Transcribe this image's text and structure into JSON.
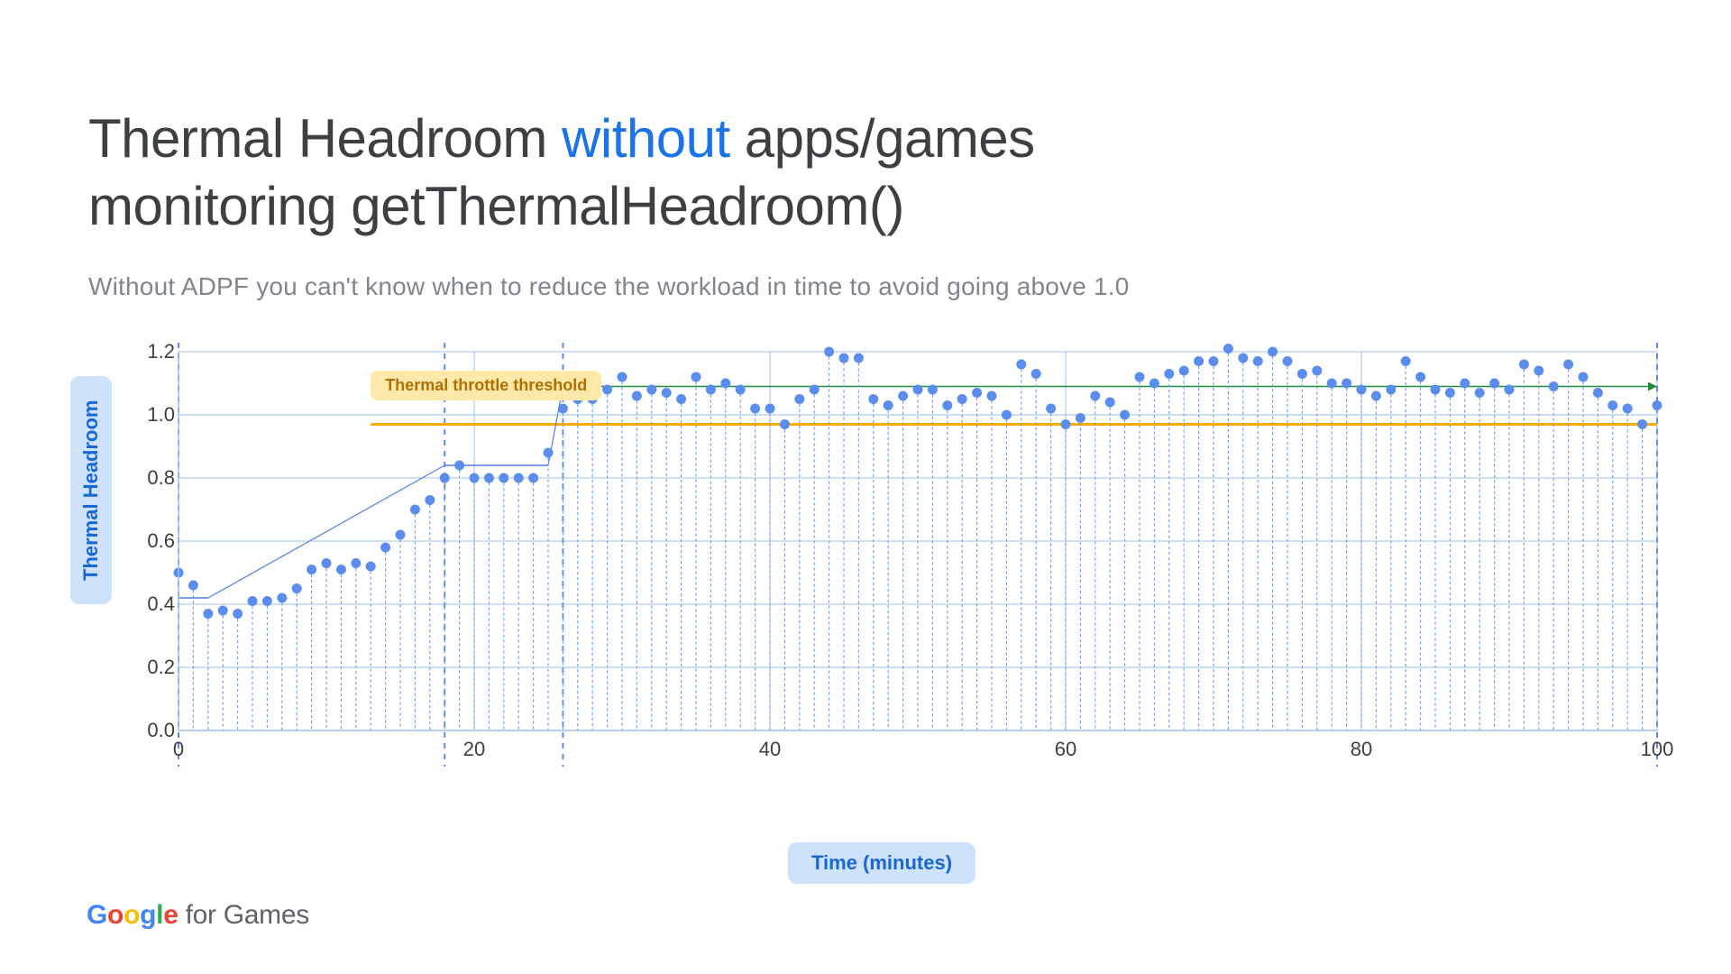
{
  "title_prefix": "Thermal Headroom ",
  "title_accent": "without",
  "title_suffix": " apps/games\nmonitoring getThermalHeadroom()",
  "subtitle": "Without ADPF you can't know when to reduce the workload in time to avoid going above 1.0",
  "ylabel": "Thermal Headroom",
  "xlabel": "Time (minutes)",
  "threshold_label": "Thermal throttle threshold",
  "footer_suffix": " for Games",
  "chart_data": {
    "type": "scatter",
    "title": "Thermal Headroom without apps/games monitoring getThermalHeadroom()",
    "xlabel": "Time (minutes)",
    "ylabel": "Thermal Headroom",
    "xlim": [
      0,
      100
    ],
    "ylim": [
      0.0,
      1.2
    ],
    "xticks": [
      0,
      20,
      40,
      60,
      80,
      100
    ],
    "yticks": [
      0.0,
      0.2,
      0.4,
      0.6,
      0.8,
      1.0,
      1.2
    ],
    "reference_lines": {
      "thermal_throttle_threshold_y": 0.97,
      "steady_state_y": 1.09,
      "vertical_dashed_x": [
        0,
        18,
        26,
        100
      ]
    },
    "x": [
      0,
      1,
      2,
      3,
      4,
      5,
      6,
      7,
      8,
      9,
      10,
      11,
      12,
      13,
      14,
      15,
      16,
      17,
      18,
      19,
      20,
      21,
      22,
      23,
      24,
      25,
      26,
      27,
      28,
      29,
      30,
      31,
      32,
      33,
      34,
      35,
      36,
      37,
      38,
      39,
      40,
      41,
      42,
      43,
      44,
      45,
      46,
      47,
      48,
      49,
      50,
      51,
      52,
      53,
      54,
      55,
      56,
      57,
      58,
      59,
      60,
      61,
      62,
      63,
      64,
      65,
      66,
      67,
      68,
      69,
      70,
      71,
      72,
      73,
      74,
      75,
      76,
      77,
      78,
      79,
      80,
      81,
      82,
      83,
      84,
      85,
      86,
      87,
      88,
      89,
      90,
      91,
      92,
      93,
      94,
      95,
      96,
      97,
      98,
      99,
      100
    ],
    "values": [
      0.5,
      0.46,
      0.37,
      0.38,
      0.37,
      0.41,
      0.41,
      0.42,
      0.45,
      0.51,
      0.53,
      0.51,
      0.53,
      0.52,
      0.58,
      0.62,
      0.7,
      0.73,
      0.8,
      0.84,
      0.8,
      0.8,
      0.8,
      0.8,
      0.8,
      0.88,
      1.02,
      1.05,
      1.05,
      1.08,
      1.12,
      1.06,
      1.08,
      1.07,
      1.05,
      1.12,
      1.08,
      1.1,
      1.08,
      1.02,
      1.02,
      0.97,
      1.05,
      1.08,
      1.2,
      1.18,
      1.18,
      1.05,
      1.03,
      1.06,
      1.08,
      1.08,
      1.03,
      1.05,
      1.07,
      1.06,
      1.0,
      1.16,
      1.13,
      1.02,
      0.97,
      0.99,
      1.06,
      1.04,
      1.0,
      1.12,
      1.1,
      1.13,
      1.14,
      1.17,
      1.17,
      1.21,
      1.18,
      1.17,
      1.2,
      1.17,
      1.13,
      1.14,
      1.1,
      1.1,
      1.08,
      1.06,
      1.08,
      1.17,
      1.12,
      1.08,
      1.07,
      1.1,
      1.07,
      1.1,
      1.08,
      1.16,
      1.14,
      1.09,
      1.16,
      1.12,
      1.07,
      1.03,
      1.02,
      0.97,
      1.03
    ],
    "step_segments": [
      {
        "y": 0.42,
        "x1": 0,
        "x2": 2
      },
      {
        "y": 0.84,
        "x1": 18,
        "x2": 25
      },
      {
        "y": 0.97,
        "x1": 13,
        "x2": 100
      },
      {
        "y": 1.09,
        "x1": 26,
        "x2": 100
      }
    ],
    "diag_segments": [
      {
        "x1": 2,
        "y1": 0.42,
        "x2": 18,
        "y2": 0.84
      },
      {
        "x1": 25,
        "y1": 0.84,
        "x2": 26,
        "y2": 1.09
      }
    ]
  }
}
